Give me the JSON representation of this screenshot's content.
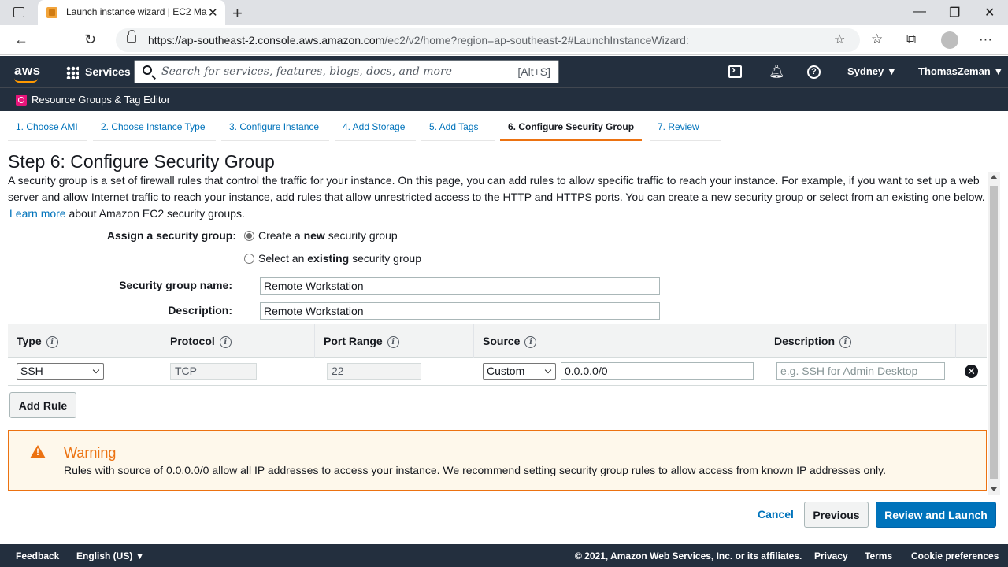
{
  "browser": {
    "tab_title": "Launch instance wizard | EC2 Ma",
    "url_host": "https://ap-southeast-2.console.aws.amazon.com",
    "url_path": "/ec2/v2/home?region=ap-southeast-2#LaunchInstanceWizard:"
  },
  "aws_header": {
    "logo": "aws",
    "services_label": "Services",
    "search_placeholder": "Search for services, features, blogs, docs, and more",
    "search_hint": "[Alt+S]",
    "region": "Sydney ▼",
    "user": "ThomasZeman ▼",
    "resource_groups": "Resource Groups & Tag Editor"
  },
  "wizard_steps": [
    {
      "label": "1. Choose AMI"
    },
    {
      "label": "2. Choose Instance Type"
    },
    {
      "label": "3. Configure Instance"
    },
    {
      "label": "4. Add Storage"
    },
    {
      "label": "5. Add Tags"
    },
    {
      "label": "6. Configure Security Group"
    },
    {
      "label": "7. Review"
    }
  ],
  "page": {
    "title": "Step 6: Configure Security Group",
    "intro": "A security group is a set of firewall rules that control the traffic for your instance. On this page, you can add rules to allow specific traffic to reach your instance. For example, if you want to set up a web server and allow Internet traffic to reach your instance, add rules that allow unrestricted access to the HTTP and HTTPS ports. You can create a new security group or select from an existing one below.",
    "learn_more": "Learn more",
    "learn_more_suffix": " about Amazon EC2 security groups."
  },
  "form": {
    "assign_label": "Assign a security group:",
    "option_new_pre": "Create a ",
    "option_new_bold": "new",
    "option_new_post": " security group",
    "option_existing_pre": "Select an ",
    "option_existing_bold": "existing",
    "option_existing_post": " security group",
    "name_label": "Security group name:",
    "name_value": "Remote Workstation",
    "description_label": "Description:",
    "description_value": "Remote Workstation"
  },
  "rules": {
    "headers": {
      "type": "Type",
      "protocol": "Protocol",
      "port_range": "Port Range",
      "source": "Source",
      "description": "Description"
    },
    "row": {
      "type": "SSH",
      "protocol": "TCP",
      "port_range": "22",
      "source_mode": "Custom",
      "source_cidr": "0.0.0.0/0",
      "description_placeholder": "e.g. SSH for Admin Desktop"
    },
    "add_rule_label": "Add Rule"
  },
  "warning": {
    "title": "Warning",
    "text": "Rules with source of 0.0.0.0/0 allow all IP addresses to access your instance. We recommend setting security group rules to allow access from known IP addresses only."
  },
  "actions": {
    "cancel": "Cancel",
    "previous": "Previous",
    "review_launch": "Review and Launch"
  },
  "footer": {
    "feedback": "Feedback",
    "language": "English (US) ▼",
    "copyright": "© 2021, Amazon Web Services, Inc. or its affiliates.",
    "privacy": "Privacy",
    "terms": "Terms",
    "cookies": "Cookie preferences"
  },
  "colors": {
    "aws_nav": "#232f3e",
    "link": "#0073bb",
    "accent": "#ec7211"
  }
}
